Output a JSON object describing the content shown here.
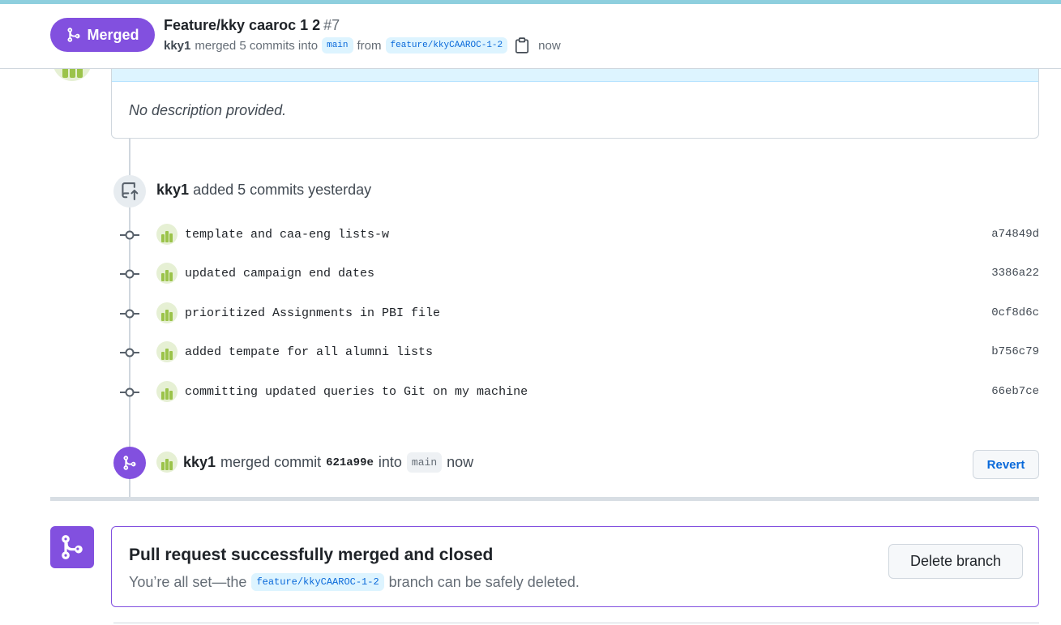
{
  "header": {
    "status_badge": "Merged",
    "title": "Feature/kky caaroc 1 2",
    "number": "#7",
    "author": "kky1",
    "merged_text": "merged 5 commits into",
    "base_branch": "main",
    "from_text": "from",
    "head_branch": "feature/kkyCAAROC-1-2",
    "time": "now"
  },
  "description": {
    "text": "No description provided."
  },
  "push_event": {
    "user": "kky1",
    "text": "added 5 commits yesterday"
  },
  "commits": [
    {
      "message": "template and caa-eng lists-w",
      "sha": "a74849d"
    },
    {
      "message": "updated campaign end dates",
      "sha": "3386a22"
    },
    {
      "message": "prioritized Assignments in PBI file",
      "sha": "0cf8d6c"
    },
    {
      "message": "added tempate for all alumni lists",
      "sha": "b756c79"
    },
    {
      "message": "committing updated queries to Git on my machine",
      "sha": "66eb7ce"
    }
  ],
  "merge_event": {
    "user": "kky1",
    "text": "merged commit",
    "sha": "621a99e",
    "into_text": "into",
    "branch": "main",
    "time": "now",
    "revert_label": "Revert"
  },
  "merged_box": {
    "title": "Pull request successfully merged and closed",
    "desc_prefix": "You’re all set—the",
    "branch": "feature/kkyCAAROC-1-2",
    "desc_suffix": "branch can be safely deleted.",
    "delete_label": "Delete branch"
  },
  "colors": {
    "merged_purple": "#8250df",
    "link_blue": "#0969da",
    "avatar_green": "#9bc34a"
  }
}
